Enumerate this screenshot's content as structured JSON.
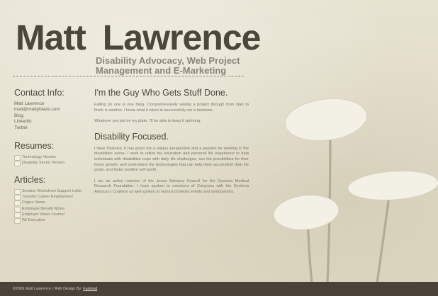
{
  "header": {
    "first_name": "Matt",
    "last_name": "Lawrence",
    "tagline": "Disability Advocacy, Web Project Management and E-Marketing"
  },
  "sidebar": {
    "contact_title": "Contact Info:",
    "contact_items": [
      "Matt Lawrence",
      "matt@mattyblaze.com",
      "Blog",
      "LinkedIn",
      "Twitter"
    ],
    "resumes_title": "Resumes:",
    "resume_items": [
      "Technology Version",
      "Disability Sector Version"
    ],
    "articles_title": "Articles:",
    "article_items": [
      "Senator Worksheet Support Letter",
      "Transfer Career Employment",
      "Cogno Views",
      "Employee Benefit Notes",
      "Employer Views Journal",
      "WI Executive"
    ]
  },
  "main": {
    "heading1": "I'm the Guy Who Gets Stuff Done.",
    "para1": "Falling on one is one thing. Comprehensively seeing a project through from start to finish is another. I know what it takes to successfully run a business.",
    "para2": "Whatever you put on my plate, I'll be able to keep it spinning.",
    "heading2": "Disability Focused.",
    "para3": "I have Dyslexia. It has given me a unique perspective and a passion for working in the disabilities arena. I seek to utilize my education and personal life experience to help individuals with disabilities cope with daily life challenges, see the possibilities for their future growth, and understand the technologies that can help them accomplish their life goals, and foster positive self worth.",
    "para4": "I am an active member of the Jones Advisory Council for the Dyslexia Medical Research Foundation. I have spoken to members of Congress with the Dyslexia Advocacy Coalition as well spoken at various Dyslexia events and symposiums."
  },
  "footer": {
    "copyright": "©2009 Matt Lawrence | Web Design By:",
    "designer_link": "Fastend"
  },
  "colors": {
    "background": "#e4e0cd",
    "heading": "#4d463b",
    "footer_bg": "#4a4239",
    "plant": "#f3f0e6"
  }
}
